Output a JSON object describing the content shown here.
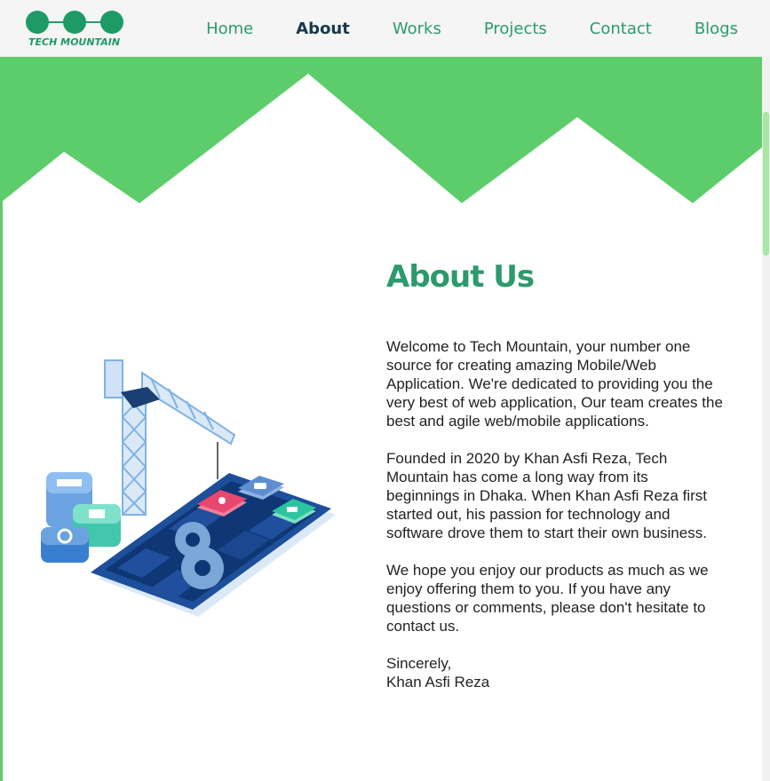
{
  "colors": {
    "brand_green": "#2c9a6c",
    "hero_green": "#5ccd6a",
    "nav_active": "#17384a",
    "navbar_bg": "#f5f5f5"
  },
  "logo": {
    "text": "TECH MOUNTAIN",
    "icon": "three-circles-logo-icon"
  },
  "nav": {
    "items": [
      {
        "label": "Home",
        "active": false
      },
      {
        "label": "About",
        "active": true
      },
      {
        "label": "Works",
        "active": false
      },
      {
        "label": "Projects",
        "active": false
      },
      {
        "label": "Contact",
        "active": false
      },
      {
        "label": "Blogs",
        "active": false
      }
    ]
  },
  "about": {
    "title": "About Us",
    "paragraphs": [
      "Welcome to Tech Mountain, your number one source for creating amazing Mobile/Web Application. We're dedicated to providing you the very best of web application, Our team creates the best and agile web/mobile applications.",
      "Founded in 2020 by Khan Asfi Reza, Tech Mountain has come a long way from its beginnings in Dhaka. When Khan Asfi Reza first started out, his passion for technology and software drove them to start their own business.",
      "We hope you enjoy our products as much as we enjoy offering them to you. If you have any questions or comments, please don't hesitate to contact us."
    ],
    "signoff": "Sincerely,",
    "signature": "Khan Asfi Reza"
  },
  "illustration": {
    "icon": "construction-crane-app-illustration"
  }
}
